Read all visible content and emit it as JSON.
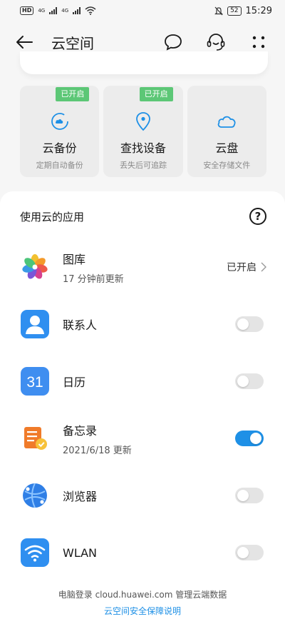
{
  "status_bar": {
    "hd": "HD",
    "net1": "4G",
    "net2": "4G",
    "battery": "52",
    "time": "15:29"
  },
  "header": {
    "title": "云空间",
    "icons": [
      "back-arrow-icon",
      "chat-bubble-icon",
      "customer-service-icon",
      "more-icon"
    ]
  },
  "tiles": [
    {
      "title": "云备份",
      "subtitle": "定期自动备份",
      "badge": "已开启",
      "icon": "cloud-backup-icon"
    },
    {
      "title": "查找设备",
      "subtitle": "丢失后可追踪",
      "badge": "已开启",
      "icon": "location-pin-icon"
    },
    {
      "title": "云盘",
      "subtitle": "安全存储文件",
      "badge": "",
      "icon": "cloud-icon"
    }
  ],
  "section": {
    "title": "使用云的应用",
    "help": "?"
  },
  "apps": [
    {
      "name": "图库",
      "subtitle": "17 分钟前更新",
      "status": "已开启",
      "enabled": true
    },
    {
      "name": "联系人",
      "subtitle": "",
      "enabled": false
    },
    {
      "name": "日历",
      "subtitle": "",
      "icon_text": "31",
      "enabled": false
    },
    {
      "name": "备忘录",
      "subtitle": "2021/6/18 更新",
      "enabled": true
    },
    {
      "name": "浏览器",
      "subtitle": "",
      "enabled": false
    },
    {
      "name": "WLAN",
      "subtitle": "",
      "enabled": false
    }
  ],
  "footer": {
    "line": "电脑登录 cloud.huawei.com 管理云端数据",
    "link": "云空间安全保障说明"
  },
  "colors": {
    "accent": "#1e90e6",
    "badge_green": "#5cc776",
    "tile_bg": "#ececec"
  }
}
